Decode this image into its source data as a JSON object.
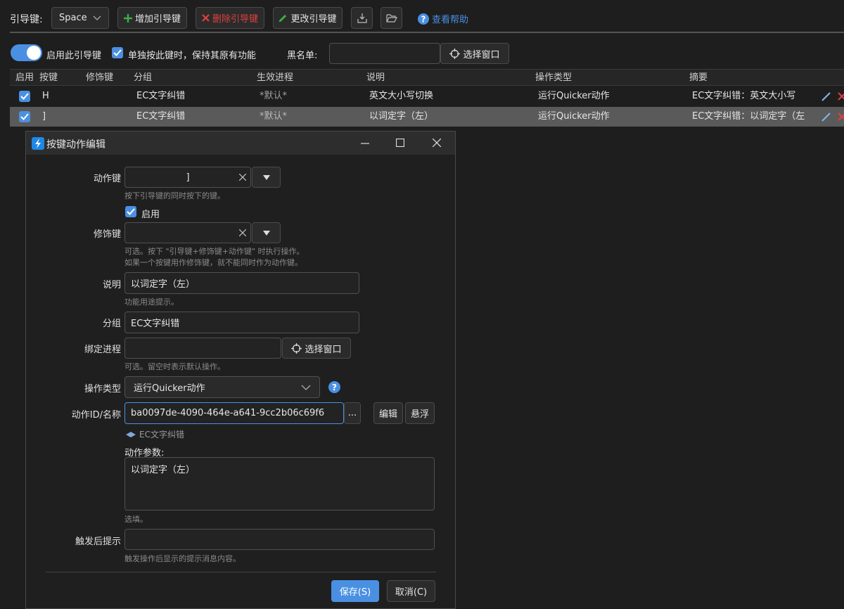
{
  "toolbar": {
    "leader_key_label": "引导键:",
    "leader_key_value": "Space",
    "add_label": "增加引导键",
    "delete_label": "删除引导键",
    "change_label": "更改引导键",
    "help_label": "查看帮助"
  },
  "options": {
    "enable_label": "启用此引导键",
    "keep_function_label": "单独按此键时，保持其原有功能",
    "blacklist_label": "黑名单:",
    "blacklist_value": "",
    "select_window_label": "选择窗口"
  },
  "table": {
    "headers": [
      "启用",
      "按键",
      "修饰键",
      "分组",
      "生效进程",
      "说明",
      "操作类型",
      "摘要"
    ],
    "rows": [
      {
        "key": "H",
        "modifier": "",
        "group": "EC文字纠错",
        "process": "*默认*",
        "desc": "英文大小写切换",
        "type": "运行Quicker动作",
        "summary": "EC文字纠错：英文大小写"
      },
      {
        "key": "]",
        "modifier": "",
        "group": "EC文字纠错",
        "process": "*默认*",
        "desc": "以词定字（左）",
        "type": "运行Quicker动作",
        "summary": "EC文字纠错：以词定字（左"
      }
    ]
  },
  "dialog": {
    "title": "按键动作编辑",
    "action_key_label": "动作键",
    "action_key_value": "]",
    "action_key_hint": "按下引导键的同时按下的键。",
    "enable_label": "启用",
    "modifier_label": "修饰键",
    "modifier_value": "",
    "modifier_hint1": "可选。按下 \"引导键+修饰键+动作键\" 时执行操作。",
    "modifier_hint2": "如果一个按键用作修饰键，就不能同时作为动作键。",
    "desc_label": "说明",
    "desc_value": "以词定字（左）",
    "desc_hint": "功能用途提示。",
    "group_label": "分组",
    "group_value": "EC文字纠错",
    "process_label": "绑定进程",
    "process_value": "",
    "process_select_label": "选择窗口",
    "process_hint": "可选。留空时表示默认操作。",
    "op_type_label": "操作类型",
    "op_type_value": "运行Quicker动作",
    "action_id_label": "动作ID/名称",
    "action_id_value": "ba0097de-4090-464e-a641-9cc2b06c69f6",
    "ellipsis_label": "...",
    "edit_label": "编辑",
    "float_label": "悬浮",
    "action_name": "EC文字纠错",
    "params_label": "动作参数:",
    "params_value": "以词定字（左）",
    "params_hint": "选填。",
    "after_label": "触发后提示",
    "after_value": "",
    "after_hint": "触发操作后显示的提示消息内容。",
    "save_label": "保存(S)",
    "cancel_label": "取消(C)"
  },
  "colors": {
    "accent": "#4a90e2",
    "delete": "#e04040",
    "add": "#3cb043"
  }
}
